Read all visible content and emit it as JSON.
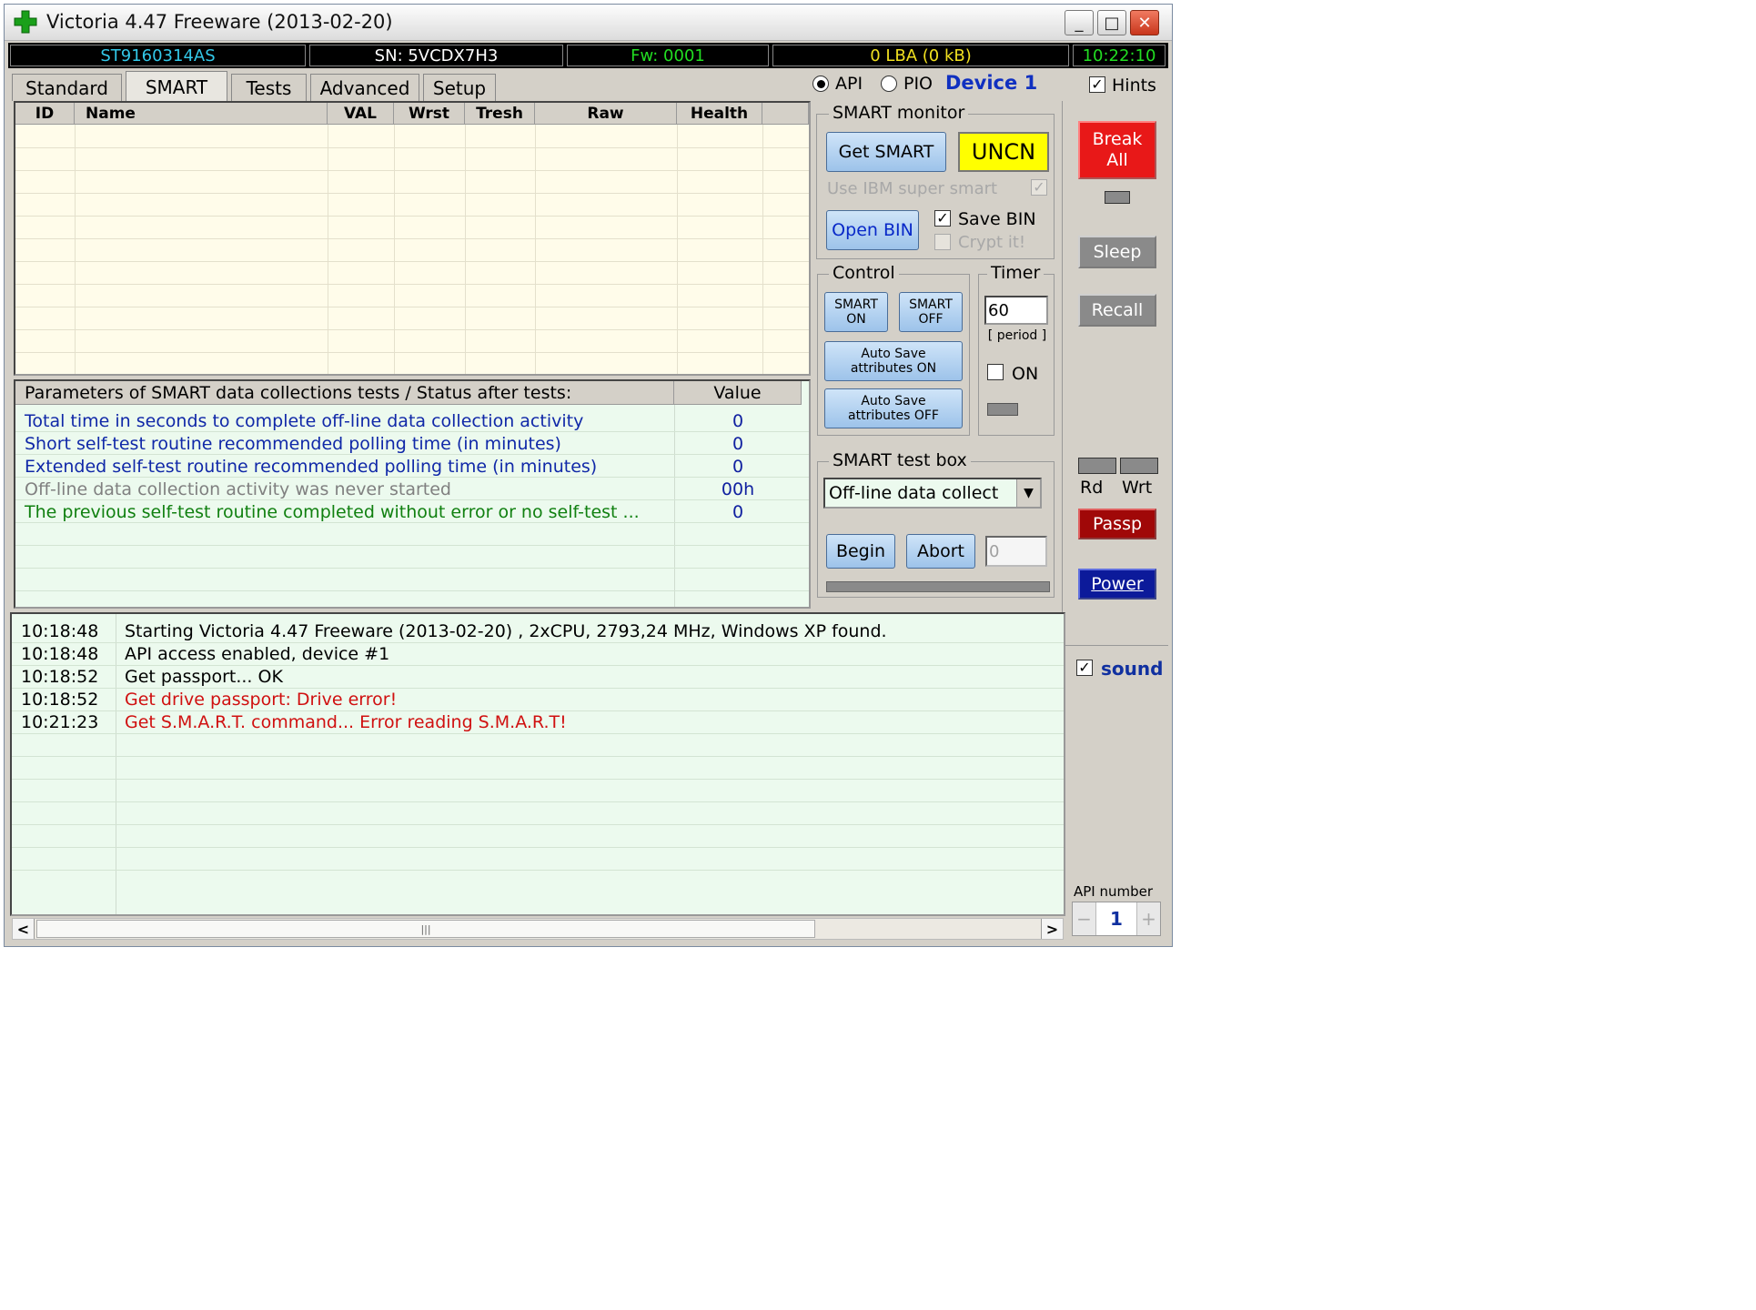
{
  "window": {
    "title": "Victoria 4.47  Freeware (2013-02-20)",
    "controls": {
      "minimize": "_",
      "maximize": "□",
      "close": "✕"
    }
  },
  "statusbar": {
    "model": "ST9160314AS",
    "serial": "SN: 5VCDX7H3",
    "firmware": "Fw: 0001",
    "lba": "0 LBA (0 kB)",
    "time": "10:22:10",
    "colors": {
      "model": "#33c8e8",
      "serial": "#ffffff",
      "firmware": "#22dd22",
      "lba": "#f0e020",
      "time": "#22dd22"
    }
  },
  "tabs": [
    "Standard",
    "SMART",
    "Tests",
    "Advanced",
    "Setup"
  ],
  "active_tab": "SMART",
  "mode": {
    "api": "API",
    "pio": "PIO",
    "device": "Device 1",
    "hints": "Hints",
    "selected": "API"
  },
  "smart_table": {
    "columns": [
      "ID",
      "Name",
      "VAL",
      "Wrst",
      "Tresh",
      "Raw",
      "Health"
    ]
  },
  "params": {
    "header": "Parameters of SMART data collections tests / Status after tests:",
    "value_header": "Value",
    "rows": [
      {
        "text": "Total time in seconds to complete off-line data collection activity",
        "value": "0",
        "color": "#1028a8"
      },
      {
        "text": "Short self-test routine recommended polling time (in minutes)",
        "value": "0",
        "color": "#1028a8"
      },
      {
        "text": "Extended self-test routine recommended polling time (in minutes)",
        "value": "0",
        "color": "#1028a8"
      },
      {
        "text": "Off-line data collection activity was never started",
        "value": "00h",
        "color": "#808080"
      },
      {
        "text": "The previous self-test routine completed without error or no self-test ...",
        "value": "0",
        "color": "#108010"
      }
    ]
  },
  "smart_monitor": {
    "label": "SMART monitor",
    "get_smart": "Get SMART",
    "status": "UNCN",
    "use_ibm": "Use IBM super smart",
    "open_bin": "Open BIN",
    "save_bin": "Save BIN",
    "crypt": "Crypt it!"
  },
  "control": {
    "label": "Control",
    "smart_on": [
      "SMART",
      "ON"
    ],
    "smart_off": [
      "SMART",
      "OFF"
    ],
    "autosave_on": [
      "Auto Save",
      "attributes ON"
    ],
    "autosave_off": [
      "Auto Save",
      "attributes OFF"
    ]
  },
  "timer": {
    "label": "Timer",
    "value": "60",
    "period": "[ period ]",
    "on": "ON"
  },
  "test_box": {
    "label": "SMART test box",
    "selected": "Off-line data collect",
    "begin": "Begin",
    "abort": "Abort",
    "value": "0"
  },
  "right_panel": {
    "break_all": [
      "Break",
      "All"
    ],
    "sleep": "Sleep",
    "recall": "Recall",
    "rd": "Rd",
    "wrt": "Wrt",
    "passp": "Passp",
    "power": "Power",
    "sound": "sound",
    "api_number_label": "API number",
    "api_number": "1",
    "minus": "−",
    "plus": "+"
  },
  "log": [
    {
      "time": "10:18:48",
      "msg": "Starting Victoria 4.47  Freeware (2013-02-20) , 2xCPU, 2793,24 MHz, Windows XP found.",
      "color": "#000000"
    },
    {
      "time": "10:18:48",
      "msg": "API access enabled, device #1",
      "color": "#000000"
    },
    {
      "time": "10:18:52",
      "msg": "Get passport... OK",
      "color": "#000000"
    },
    {
      "time": "10:18:52",
      "msg": "Get drive passport: Drive error!",
      "color": "#d01010"
    },
    {
      "time": "10:21:23",
      "msg": "Get S.M.A.R.T. command... Error reading S.M.A.R.T!",
      "color": "#d01010"
    }
  ],
  "scrollbar": {
    "left": "<",
    "right": ">",
    "grip": "|||"
  }
}
